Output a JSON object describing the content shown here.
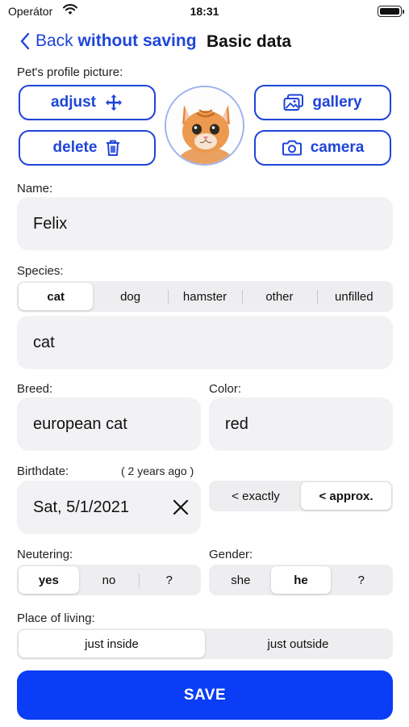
{
  "status_bar": {
    "carrier": "Operátor",
    "time": "18:31"
  },
  "nav": {
    "back_prefix": "Back",
    "back_suffix": "without saving",
    "title": "Basic data"
  },
  "profile_picture": {
    "label": "Pet's profile picture:",
    "adjust_label": "adjust",
    "delete_label": "delete",
    "gallery_label": "gallery",
    "camera_label": "camera"
  },
  "name": {
    "label": "Name:",
    "value": "Felix"
  },
  "species": {
    "label": "Species:",
    "options": [
      "cat",
      "dog",
      "hamster",
      "other",
      "unfilled"
    ],
    "selected": "cat",
    "value": "cat"
  },
  "breed": {
    "label": "Breed:",
    "value": "european cat"
  },
  "color": {
    "label": "Color:",
    "value": "red"
  },
  "birthdate": {
    "label": "Birthdate:",
    "age_hint": "( 2 years ago )",
    "value": "Sat, 5/1/2021",
    "precision_options": [
      "< exactly",
      "< approx."
    ],
    "selected": "< approx."
  },
  "neutering": {
    "label": "Neutering:",
    "options": [
      "yes",
      "no",
      "?"
    ],
    "selected": "yes"
  },
  "gender": {
    "label": "Gender:",
    "options": [
      "she",
      "he",
      "?"
    ],
    "selected": "he"
  },
  "place_of_living": {
    "label": "Place of living:",
    "options": [
      "just inside",
      "just outside"
    ],
    "selected": "just inside"
  },
  "save_label": "SAVE",
  "colors": {
    "accent": "#1f45d8",
    "save": "#0a3df5",
    "field_bg": "#f2f2f5",
    "segment_bg": "#eeeef0"
  }
}
